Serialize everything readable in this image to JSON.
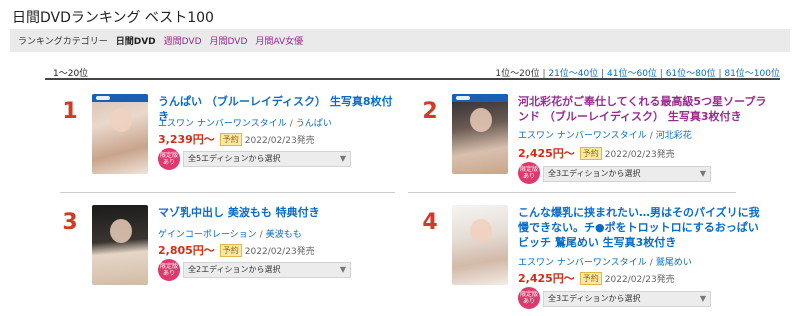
{
  "page_title": "日間DVDランキング ベスト100",
  "category_bar": {
    "label": "ランキングカテゴリー",
    "items": [
      {
        "label": "日間DVD",
        "active": true
      },
      {
        "label": "週間DVD",
        "active": false
      },
      {
        "label": "月間DVD",
        "active": false
      },
      {
        "label": "月間AV女優",
        "active": false
      }
    ]
  },
  "range_bar": {
    "current": "1〜20位",
    "pager": [
      "1位〜20位",
      "21位〜40位",
      "41位〜60位",
      "61位〜80位",
      "81位〜100位"
    ],
    "separator": " | "
  },
  "items": [
    {
      "rank": "1",
      "title": "うんぱい （ブルーレイディスク） 生写真8枚付き",
      "maker": "エスワン ナンバーワンスタイル",
      "actress": "うんぱい",
      "price": "3,239円〜",
      "badge": "予約",
      "release": "2022/02/23発売",
      "limited": "限定版あり",
      "select": "全5エディションから選択"
    },
    {
      "rank": "2",
      "title": "河北彩花がご奉仕してくれる最高級5つ星ソープランド （ブルーレイディスク） 生写真3枚付き",
      "maker": "エスワン ナンバーワンスタイル",
      "actress": "河北彩花",
      "price": "2,425円〜",
      "badge": "予約",
      "release": "2022/02/23発売",
      "limited": "限定版あり",
      "select": "全3エディションから選択"
    },
    {
      "rank": "3",
      "title": "マゾ乳中出し 美波もも 特典付き",
      "maker": "ゲインコーポレーション",
      "actress": "美波もも",
      "price": "2,805円〜",
      "badge": "予約",
      "release": "2022/02/23発売",
      "limited": "限定版あり",
      "select": "全2エディションから選択"
    },
    {
      "rank": "4",
      "title": "こんな爆乳に挟まれたい…男はそのパイズリに我慢できない。チ●ポをトロットロにするおっぱいビッチ 鷲尾めい 生写真3枚付き",
      "maker": "エスワン ナンバーワンスタイル",
      "actress": "鷲尾めい",
      "price": "2,425円〜",
      "badge": "予約",
      "release": "2022/02/23発売",
      "limited": "限定版あり",
      "select": "全3エディションから選択"
    }
  ],
  "colors": {
    "accent_link": "#0a6cc9",
    "title_purple": "#9b2a8f",
    "rank_red": "#d23a24",
    "price_red": "#d22d1a",
    "limited_pink": "#e0386e"
  }
}
